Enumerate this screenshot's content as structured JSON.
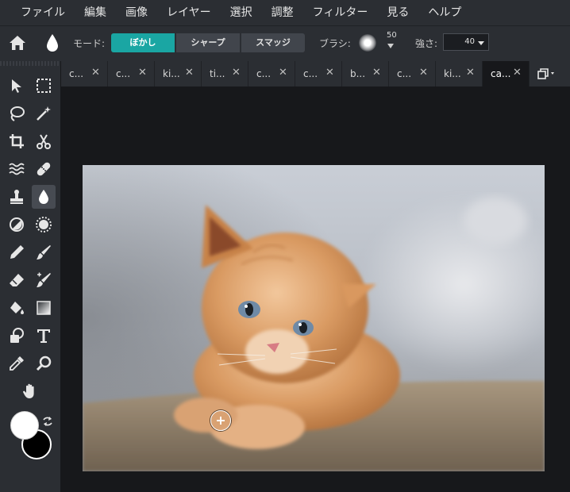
{
  "menu": [
    "ファイル",
    "編集",
    "画像",
    "レイヤー",
    "選択",
    "調整",
    "フィルター",
    "見る",
    "ヘルプ"
  ],
  "options": {
    "mode_label": "モード:",
    "modes": [
      "ぼかし",
      "シャープ",
      "スマッジ"
    ],
    "active_mode": "ぼかし",
    "brush_label": "ブラシ:",
    "brush_size": "50",
    "strength_label": "強さ:",
    "strength_value": "40"
  },
  "tabs": [
    {
      "label": "c..."
    },
    {
      "label": "c..."
    },
    {
      "label": "ki..."
    },
    {
      "label": "ti..."
    },
    {
      "label": "c..."
    },
    {
      "label": "c..."
    },
    {
      "label": "b..."
    },
    {
      "label": "c..."
    },
    {
      "label": "ki..."
    },
    {
      "label": "ca..."
    }
  ],
  "tab_close": "✕",
  "colors": {
    "accent": "#1aa6a3",
    "foreground": "#ffffff",
    "background": "#000000"
  },
  "tools": [
    "select-arrow-icon",
    "marquee-icon",
    "lasso-icon",
    "magic-wand-icon",
    "crop-icon",
    "scissors-icon",
    "liquify-icon",
    "bandage-icon",
    "stamp-icon",
    "blur-drop-icon",
    "dodge-icon",
    "sponge-icon",
    "pencil-icon",
    "brush-icon",
    "eraser-icon",
    "color-replace-icon",
    "bucket-icon",
    "gradient-icon",
    "shape-icon",
    "text-icon",
    "eyedropper-icon",
    "zoom-icon",
    "hand-icon"
  ],
  "image": {
    "subject": "kitten"
  }
}
